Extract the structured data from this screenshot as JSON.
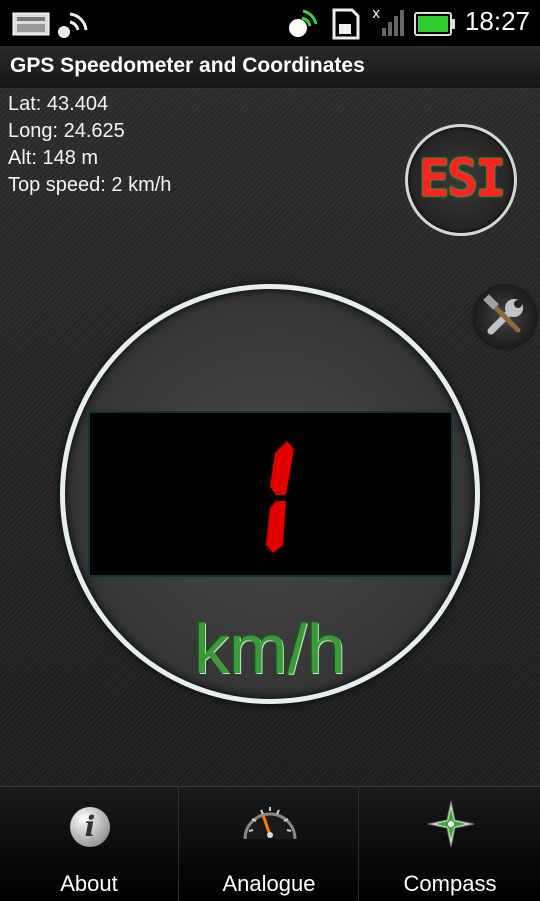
{
  "status_bar": {
    "time": "18:27",
    "icons": [
      "gallery-icon",
      "gps-signal-icon",
      "gps-satellite-icon",
      "sd-card-icon",
      "signal-off-icon",
      "battery-icon"
    ]
  },
  "app": {
    "title": "GPS Speedometer and Coordinates"
  },
  "info": {
    "lat": "Lat: 43.404",
    "long": "Long: 24.625",
    "alt": "Alt: 148 m",
    "top_speed": "Top speed: 2 km/h"
  },
  "logo": {
    "text": "ESI"
  },
  "speed": {
    "value": "1",
    "unit": "km/h"
  },
  "bottom_nav": [
    {
      "label": "About",
      "icon": "info-icon"
    },
    {
      "label": "Analogue",
      "icon": "speedometer-icon"
    },
    {
      "label": "Compass",
      "icon": "compass-icon"
    }
  ],
  "colors": {
    "seven_segment": "#e10000",
    "unit_text": "#3b9a3b",
    "logo_red": "#ff2020",
    "logo_green": "#40ff40"
  }
}
